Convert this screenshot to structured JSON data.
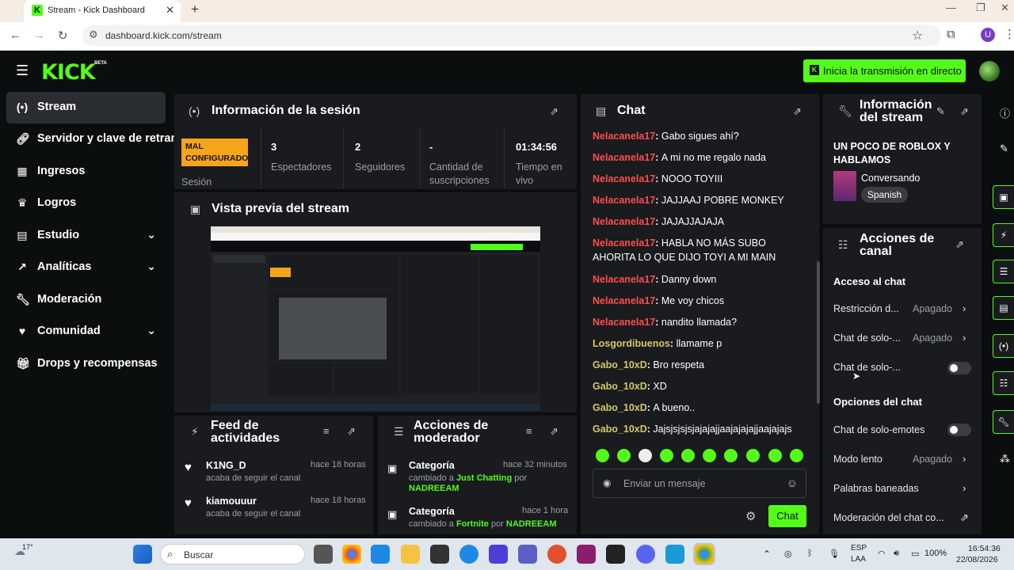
{
  "browser": {
    "tab_title": "Stream - Kick Dashboard",
    "url": "dashboard.kick.com/stream",
    "profile_letter": "U"
  },
  "header": {
    "logo": "KICK",
    "beta": "BETA",
    "go_live_label": "Inicia la transmisión en directo"
  },
  "sidebar": {
    "items": [
      {
        "label": "Stream",
        "icon": "broadcast-icon",
        "active": true
      },
      {
        "label": "Servidor y clave de retransmisión",
        "icon": "link-icon"
      },
      {
        "label": "Ingresos",
        "icon": "money-icon"
      },
      {
        "label": "Logros",
        "icon": "trophy-icon"
      },
      {
        "label": "Estudio",
        "icon": "studio-icon",
        "expandable": true
      },
      {
        "label": "Analíticas",
        "icon": "chart-icon",
        "expandable": true
      },
      {
        "label": "Moderación",
        "icon": "wrench-icon"
      },
      {
        "label": "Comunidad",
        "icon": "heart-icon",
        "expandable": true
      },
      {
        "label": "Drops y recompensas",
        "icon": "gift-icon"
      }
    ]
  },
  "session": {
    "title": "Información de la sesión",
    "status_badge": "MAL CONFIGURADO",
    "status_label": "Sesión",
    "stats": [
      {
        "value": "3",
        "label": "Espectadores"
      },
      {
        "value": "2",
        "label": "Seguidores"
      },
      {
        "value": "-",
        "label": "Cantidad de suscripciones"
      },
      {
        "value": "01:34:56",
        "label": "Tiempo en vivo"
      }
    ]
  },
  "preview": {
    "title": "Vista previa del stream"
  },
  "activity": {
    "title": "Feed de actividades",
    "items": [
      {
        "name": "K1NG_D",
        "time": "hace 18 horas",
        "desc": "acaba de seguir el canal"
      },
      {
        "name": "kiamouuur",
        "time": "hace 18 horas",
        "desc": "acaba de seguir el canal"
      }
    ]
  },
  "mod_actions": {
    "title": "Acciones de moderador",
    "items": [
      {
        "name": "Categoría",
        "time": "hace 32 minutos",
        "prefix": "cambiado a",
        "category": "Just Chatting",
        "by": "por",
        "user": "NADREEAM"
      },
      {
        "name": "Categoría",
        "time": "hace 1 hora",
        "prefix": "cambiado a",
        "category": "Fortnite",
        "by": "por",
        "user": "NADREEAM"
      }
    ]
  },
  "chat": {
    "title": "Chat",
    "messages": [
      {
        "user": "Nelacanela17",
        "text": "Gabo sigues ahí?",
        "color": "#ff4d4d"
      },
      {
        "user": "Nelacanela17",
        "text": "A mi no me regalo nada",
        "color": "#ff4d4d"
      },
      {
        "user": "Nelacanela17",
        "text": "NOOO TOYIII",
        "color": "#ff4d4d"
      },
      {
        "user": "Nelacanela17",
        "text": "JAJJAAJ POBRE MONKEY",
        "color": "#ff4d4d"
      },
      {
        "user": "Nelacanela17",
        "text": "JAJAJJAJAJA",
        "color": "#ff4d4d"
      },
      {
        "user": "Nelacanela17",
        "text": "HABLA NO MÁS SUBO AHORITA LO QUE DIJO TOYI A MI MAIN",
        "color": "#ff4d4d"
      },
      {
        "user": "Nelacanela17",
        "text": "Danny down",
        "color": "#ff4d4d"
      },
      {
        "user": "Nelacanela17",
        "text": "Me voy chicos",
        "color": "#ff4d4d"
      },
      {
        "user": "Nelacanela17",
        "text": "nandito llamada?",
        "color": "#ff4d4d"
      },
      {
        "user": "Losgordibuenos",
        "text": "llamame p",
        "color": "#d4c86a"
      },
      {
        "user": "Gabo_10xD",
        "text": "Bro respeta",
        "color": "#d4c86a"
      },
      {
        "user": "Gabo_10xD",
        "text": "XD",
        "color": "#d4c86a"
      },
      {
        "user": "Gabo_10xD",
        "text": "A bueno..",
        "color": "#d4c86a"
      },
      {
        "user": "Gabo_10xD",
        "text": "Jajsjsjsjsjajajajjaajajajajjaajajajs",
        "color": "#d4c86a"
      }
    ],
    "input_placeholder": "Enviar un mensaje",
    "send_label": "Chat"
  },
  "stream_info": {
    "title": "Información del stream",
    "stream_title": "UN POCO DE ROBLOX Y HABLAMOS",
    "category": "Conversando",
    "language": "Spanish"
  },
  "channel_actions": {
    "title": "Acciones de canal",
    "access_heading": "Acceso al chat",
    "rows_access": [
      {
        "label": "Restricción d...",
        "value": "Apagado",
        "type": "chevron"
      },
      {
        "label": "Chat de solo-...",
        "value": "Apagado",
        "type": "chevron"
      },
      {
        "label": "Chat de solo-...",
        "value": "",
        "type": "toggle"
      }
    ],
    "options_heading": "Opciones del chat",
    "rows_options": [
      {
        "label": "Chat de solo-emotes",
        "value": "",
        "type": "toggle"
      },
      {
        "label": "Modo lento",
        "value": "Apagado",
        "type": "chevron"
      },
      {
        "label": "Palabras baneadas",
        "value": "",
        "type": "chevron"
      },
      {
        "label": "Moderación del chat co...",
        "value": "",
        "type": "external"
      }
    ]
  },
  "taskbar": {
    "weather": "17°",
    "search_placeholder": "Buscar",
    "lang1": "ESP",
    "lang2": "LAA",
    "battery": "100%",
    "time": "16:54:36",
    "date": "22/08/2026"
  },
  "colors": {
    "accent": "#53fc18",
    "warning": "#f6a51b",
    "chat_user_red": "#ff4d4d",
    "chat_user_gold": "#d4c86a"
  }
}
